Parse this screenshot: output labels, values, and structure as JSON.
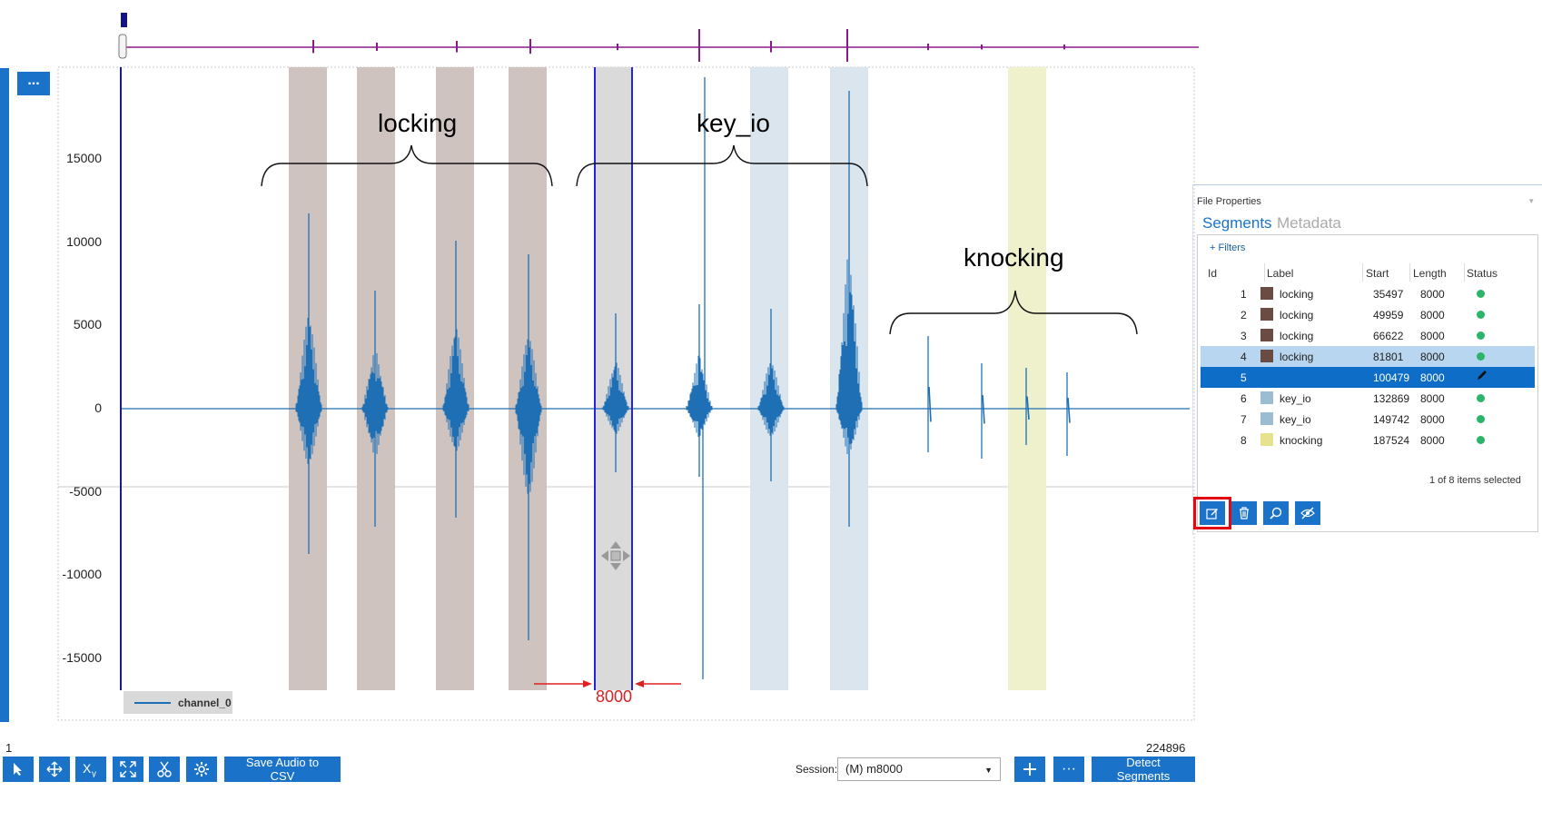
{
  "overview": {
    "track_color": "#8b1a89"
  },
  "plot": {
    "menu_label": "...",
    "y_ticks": [
      "15000",
      "10000",
      "5000",
      "0",
      "-5000",
      "-10000",
      "-15000"
    ],
    "legend_label": "channel_0",
    "annotations": {
      "locking": "locking",
      "key_io": "key_io",
      "knocking": "knocking"
    },
    "length_marker": "8000",
    "waveform_color": "#1f6fb5",
    "segment_colors": {
      "locking": "#cfc3bf",
      "key_io": "#dbe5ed",
      "knocking": "#eff0cc",
      "selected": "#dadada"
    }
  },
  "toolbar": {
    "index_start": "1",
    "index_end": "224896",
    "save_label": "Save Audio to CSV",
    "session_label": "Session:",
    "session_value": "(M) m8000",
    "more_label": "···",
    "detect_label": "Detect Segments",
    "icons": [
      "pointer-icon",
      "pan-icon",
      "xy-icon",
      "fit-icon",
      "scissors-icon",
      "settings-icon"
    ]
  },
  "panel": {
    "title": "File Properties",
    "tabs": [
      "Segments",
      "Metadata"
    ],
    "filters_label": "+ Filters",
    "columns": [
      "Id",
      "Label",
      "Start",
      "Length",
      "Status"
    ],
    "rows": [
      {
        "id": "1",
        "label": "locking",
        "start": "35497",
        "length": "8000",
        "color": "#6b4c44"
      },
      {
        "id": "2",
        "label": "locking",
        "start": "49959",
        "length": "8000",
        "color": "#6b4c44"
      },
      {
        "id": "3",
        "label": "locking",
        "start": "66622",
        "length": "8000",
        "color": "#6b4c44"
      },
      {
        "id": "4",
        "label": "locking",
        "start": "81801",
        "length": "8000",
        "color": "#6b4c44"
      },
      {
        "id": "5",
        "label": "",
        "start": "100479",
        "length": "8000",
        "color": ""
      },
      {
        "id": "6",
        "label": "key_io",
        "start": "132869",
        "length": "8000",
        "color": "#9cbcd2"
      },
      {
        "id": "7",
        "label": "key_io",
        "start": "149742",
        "length": "8000",
        "color": "#9cbcd2"
      },
      {
        "id": "8",
        "label": "knocking",
        "start": "187524",
        "length": "8000",
        "color": "#e6e28e"
      }
    ],
    "selection_text": "1 of 8 items selected"
  }
}
